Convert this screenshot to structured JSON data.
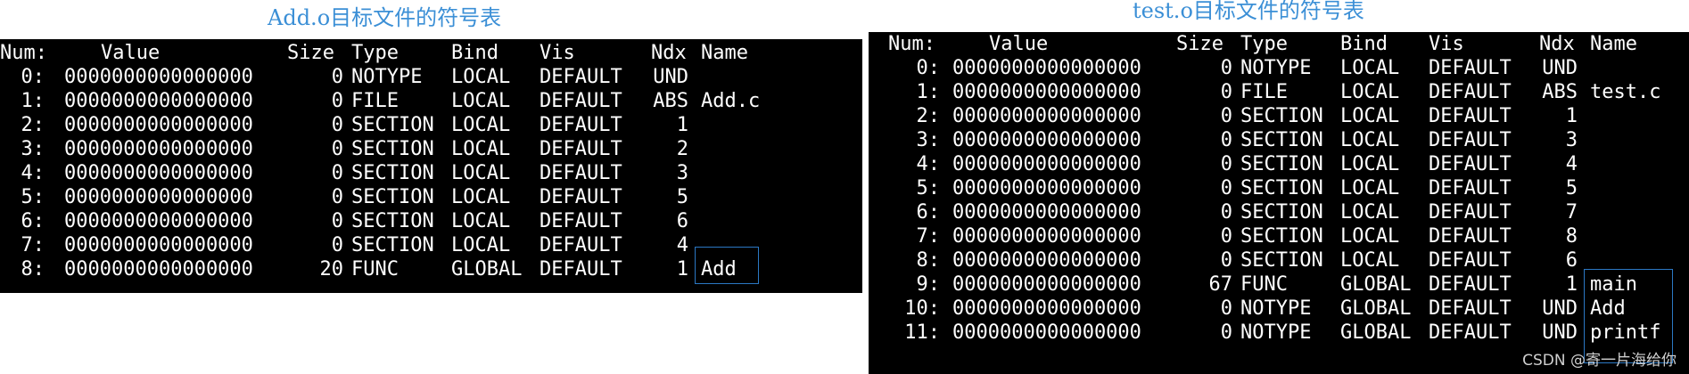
{
  "captions": {
    "left": "Add.o目标文件的符号表",
    "right": "test.o目标文件的符号表"
  },
  "columns": [
    "Num:",
    "Value",
    "Size",
    "Type",
    "Bind",
    "Vis",
    "Ndx",
    "Name"
  ],
  "left_table": [
    [
      "0:",
      "0000000000000000",
      "0",
      "NOTYPE",
      "LOCAL",
      "DEFAULT",
      "UND",
      ""
    ],
    [
      "1:",
      "0000000000000000",
      "0",
      "FILE",
      "LOCAL",
      "DEFAULT",
      "ABS",
      "Add.c"
    ],
    [
      "2:",
      "0000000000000000",
      "0",
      "SECTION",
      "LOCAL",
      "DEFAULT",
      "1",
      ""
    ],
    [
      "3:",
      "0000000000000000",
      "0",
      "SECTION",
      "LOCAL",
      "DEFAULT",
      "2",
      ""
    ],
    [
      "4:",
      "0000000000000000",
      "0",
      "SECTION",
      "LOCAL",
      "DEFAULT",
      "3",
      ""
    ],
    [
      "5:",
      "0000000000000000",
      "0",
      "SECTION",
      "LOCAL",
      "DEFAULT",
      "5",
      ""
    ],
    [
      "6:",
      "0000000000000000",
      "0",
      "SECTION",
      "LOCAL",
      "DEFAULT",
      "6",
      ""
    ],
    [
      "7:",
      "0000000000000000",
      "0",
      "SECTION",
      "LOCAL",
      "DEFAULT",
      "4",
      ""
    ],
    [
      "8:",
      "0000000000000000",
      "20",
      "FUNC",
      "GLOBAL",
      "DEFAULT",
      "1",
      "Add"
    ]
  ],
  "right_table": [
    [
      "0:",
      "0000000000000000",
      "0",
      "NOTYPE",
      "LOCAL",
      "DEFAULT",
      "UND",
      ""
    ],
    [
      "1:",
      "0000000000000000",
      "0",
      "FILE",
      "LOCAL",
      "DEFAULT",
      "ABS",
      "test.c"
    ],
    [
      "2:",
      "0000000000000000",
      "0",
      "SECTION",
      "LOCAL",
      "DEFAULT",
      "1",
      ""
    ],
    [
      "3:",
      "0000000000000000",
      "0",
      "SECTION",
      "LOCAL",
      "DEFAULT",
      "3",
      ""
    ],
    [
      "4:",
      "0000000000000000",
      "0",
      "SECTION",
      "LOCAL",
      "DEFAULT",
      "4",
      ""
    ],
    [
      "5:",
      "0000000000000000",
      "0",
      "SECTION",
      "LOCAL",
      "DEFAULT",
      "5",
      ""
    ],
    [
      "6:",
      "0000000000000000",
      "0",
      "SECTION",
      "LOCAL",
      "DEFAULT",
      "7",
      ""
    ],
    [
      "7:",
      "0000000000000000",
      "0",
      "SECTION",
      "LOCAL",
      "DEFAULT",
      "8",
      ""
    ],
    [
      "8:",
      "0000000000000000",
      "0",
      "SECTION",
      "LOCAL",
      "DEFAULT",
      "6",
      ""
    ],
    [
      "9:",
      "0000000000000000",
      "67",
      "FUNC",
      "GLOBAL",
      "DEFAULT",
      "1",
      "main"
    ],
    [
      "10:",
      "0000000000000000",
      "0",
      "NOTYPE",
      "GLOBAL",
      "DEFAULT",
      "UND",
      "Add"
    ],
    [
      "11:",
      "0000000000000000",
      "0",
      "NOTYPE",
      "GLOBAL",
      "DEFAULT",
      "UND",
      "printf"
    ]
  ],
  "watermark": "CSDN @寄一片海给你",
  "colors": {
    "terminal_bg": "#000000",
    "terminal_fg": "#ffffff",
    "caption": "#3b8fd6",
    "highlight_box": "#2b78c4"
  }
}
